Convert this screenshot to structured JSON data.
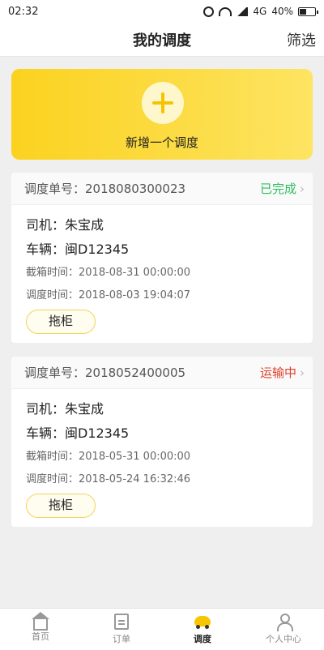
{
  "status_bar": {
    "time": "02:32",
    "network": "4G",
    "battery": "40%"
  },
  "header": {
    "title": "我的调度",
    "filter_label": "筛选"
  },
  "add_card": {
    "label": "新增一个调度"
  },
  "orders": [
    {
      "order_no": "调度单号：2018080300023",
      "status": "已完成",
      "status_color": "#2ebc5f",
      "driver": "司机：朱宝成",
      "vehicle": "车辆：闽D12345",
      "cutoff_time": "截箱时间：2018-08-31 00:00:00",
      "dispatch_time": "调度时间：2018-08-03 19:04:07",
      "action_label": "拖柜"
    },
    {
      "order_no": "调度单号：2018052400005",
      "status": "运输中",
      "status_color": "#e0402b",
      "driver": "司机：朱宝成",
      "vehicle": "车辆：闽D12345",
      "cutoff_time": "截箱时间：2018-05-31 00:00:00",
      "dispatch_time": "调度时间：2018-05-24 16:32:46",
      "action_label": "拖柜"
    }
  ],
  "tabbar": {
    "items": [
      {
        "label": "首页",
        "icon": "home-icon"
      },
      {
        "label": "订单",
        "icon": "order-icon"
      },
      {
        "label": "调度",
        "icon": "dispatch-icon",
        "active": true
      },
      {
        "label": "个人中心",
        "icon": "user-icon"
      }
    ]
  },
  "colors": {
    "accent": "#fbd21f",
    "completed": "#2ebc5f",
    "in_transit": "#e0402b"
  }
}
